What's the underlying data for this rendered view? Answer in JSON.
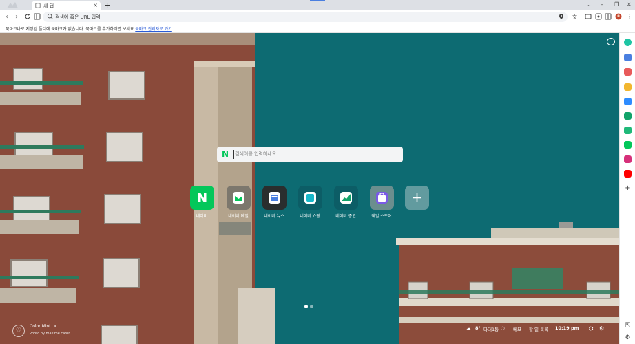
{
  "browser": {
    "tab_title": "새 탭",
    "new_tab_symbol": "+",
    "tab_close_symbol": "×",
    "window_controls": [
      "⌄",
      "–",
      "❐",
      "✕"
    ],
    "omnibox_placeholder": "검색어 혹은 URL 입력",
    "bookmark_message": "북마크바로 지정된 폴더에 북마크가 없습니다. 북마크를 추가하려면",
    "bookmark_message_mid": " 보세요 ",
    "bookmark_link": "북마크 관리자로 가기"
  },
  "search": {
    "logo_letter": "N",
    "placeholder": "검색어를 입력하세요"
  },
  "shortcuts": [
    {
      "label": "네이버",
      "color": "#03c75a",
      "icon": "naver-n-icon"
    },
    {
      "label": "네이버 메일",
      "color": "#2f8b4e",
      "icon": "mail-icon"
    },
    {
      "label": "네이버 뉴스",
      "color": "#1f3b68",
      "icon": "news-icon"
    },
    {
      "label": "네이버 쇼핑",
      "color": "#0a8b98",
      "icon": "shopping-icon"
    },
    {
      "label": "네이버 증권",
      "color": "#1f9a68",
      "icon": "stock-chart-icon"
    },
    {
      "label": "웨일 스토어",
      "color": "#6f52d8",
      "icon": "store-icon"
    },
    {
      "label": "",
      "color": "#8aa7aa",
      "icon": "add-icon"
    }
  ],
  "background": {
    "theme_name": "Color Mint",
    "theme_chevron": ">",
    "photo_credit": "Photo by maxime caron"
  },
  "status": {
    "weather_temp": "8°",
    "weather_location": "다대1동",
    "memo": "메모",
    "todo": "할 일 목록",
    "time": "10:19 pm"
  }
}
